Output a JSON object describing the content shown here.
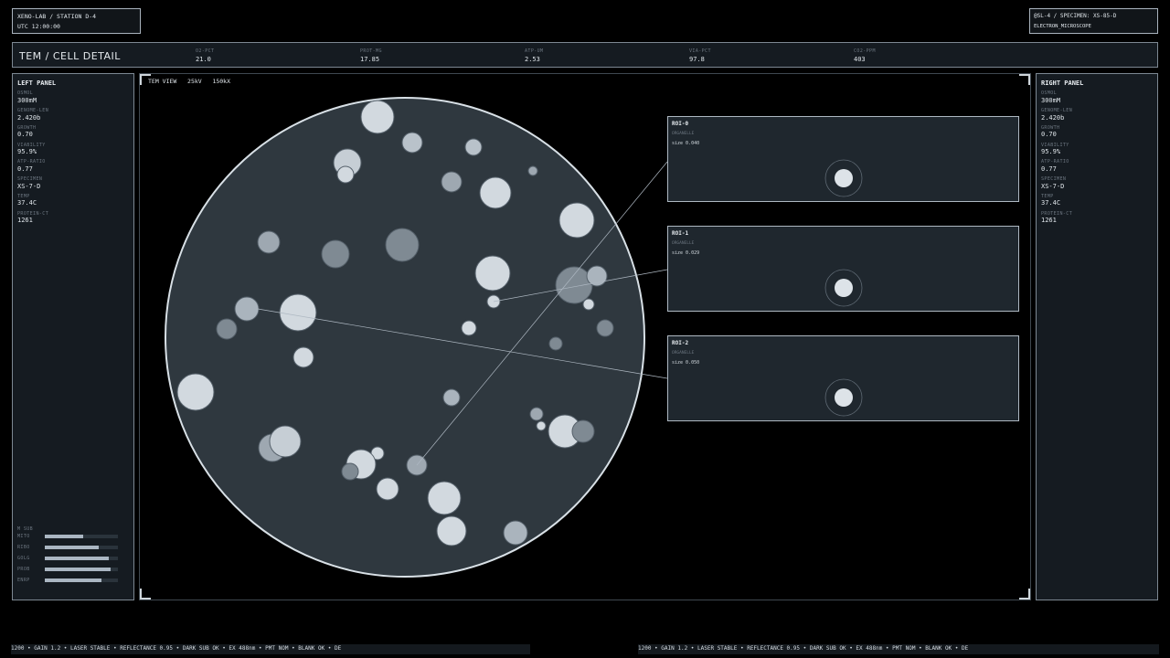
{
  "station": {
    "title": "XENO-LAB / STATION D-4",
    "time": "UTC 12:00:00"
  },
  "specimen": {
    "title": "@SL-4 / SPECIMEN: XS-85-D",
    "mode": "ELECTRON_MICROSCOPE"
  },
  "header": {
    "title": "TEM / CELL DETAIL",
    "metrics": [
      {
        "label": "O2-PCT",
        "value": "21.0"
      },
      {
        "label": "PROT-MG",
        "value": "17.85"
      },
      {
        "label": "ATP-UM",
        "value": "2.53"
      },
      {
        "label": "VIA-PCT",
        "value": "97.8"
      },
      {
        "label": "CO2-PPM",
        "value": "403"
      }
    ]
  },
  "left_panel": {
    "title": "LEFT PANEL",
    "stats": [
      {
        "label": "OSMOL",
        "value": "300mM"
      },
      {
        "label": "GENOME-LEN",
        "value": "2.420b"
      },
      {
        "label": "GROWTH",
        "value": "0.70"
      },
      {
        "label": "VIABILITY",
        "value": "95.9%"
      },
      {
        "label": "ATP-RATIO",
        "value": "0.77"
      },
      {
        "label": "SPECIMEN",
        "value": "XS-7-D"
      },
      {
        "label": "TEMP",
        "value": "37.4C"
      },
      {
        "label": "PROTEIN-CT",
        "value": "1261"
      }
    ],
    "subsystems_title": "M SUB",
    "subsystems": [
      {
        "label": "MITO",
        "level": 0.52
      },
      {
        "label": "RIBO",
        "level": 0.74
      },
      {
        "label": "GOLG",
        "level": 0.88
      },
      {
        "label": "PROB",
        "level": 0.9
      },
      {
        "label": "ENRP",
        "level": 0.78
      }
    ]
  },
  "right_panel": {
    "title": "RIGHT PANEL",
    "stats": [
      {
        "label": "OSMOL",
        "value": "300mM"
      },
      {
        "label": "GENOME-LEN",
        "value": "2.420b"
      },
      {
        "label": "GROWTH",
        "value": "0.70"
      },
      {
        "label": "VIABILITY",
        "value": "95.9%"
      },
      {
        "label": "ATP-RATIO",
        "value": "0.77"
      },
      {
        "label": "SPECIMEN",
        "value": "XS-7-D"
      },
      {
        "label": "TEMP",
        "value": "37.4C"
      },
      {
        "label": "PROTEIN-CT",
        "value": "1261"
      }
    ]
  },
  "viewer": {
    "label": "TEM VIEW   25kV   150kX"
  },
  "rois": [
    {
      "name": "ROI-0",
      "class": "ORGANELLE",
      "size": "size 0.040"
    },
    {
      "name": "ROI-1",
      "class": "ORGANELLE",
      "size": "size 0.029"
    },
    {
      "name": "ROI-2",
      "class": "ORGANELLE",
      "size": "size 0.050"
    }
  ],
  "ticker": {
    "left": "1200  •  GAIN 1.2  •  LASER STABLE  •  REFLECTANCE 0.95  •  DARK SUB OK  •  EX 488nm  •  PMT NOM  •  BLANK OK  •  DE",
    "right": "1200  •  GAIN 1.2  •  LASER STABLE  •  REFLECTANCE 0.95  •  DARK SUB OK  •  EX 488nm  •  PMT NOM  •  BLANK OK  •  DE"
  },
  "colors": {
    "accent": "#aeb8c2",
    "background": "#000000",
    "panel": "#151b21",
    "cell": "#2f383f"
  }
}
